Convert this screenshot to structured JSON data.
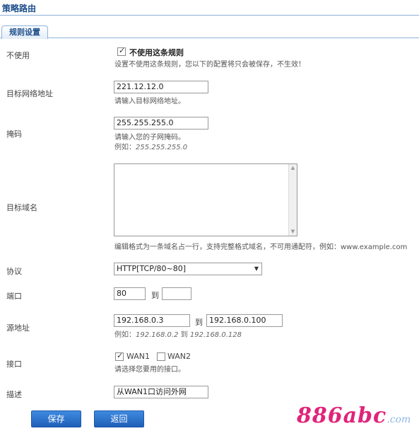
{
  "page": {
    "title": "策略路由"
  },
  "tabs": [
    {
      "label": "规则设置",
      "active": true
    }
  ],
  "form": {
    "disable": {
      "label": "不使用",
      "checkbox_label": "不使用这条规则",
      "checked": true,
      "hint": "设置不使用这条规则，您以下的配置将只会被保存，不生效！"
    },
    "dest_network": {
      "label": "目标网络地址",
      "value": "221.12.12.0",
      "hint": "请输入目标网络地址。"
    },
    "mask": {
      "label": "掩码",
      "value": "255.255.255.0",
      "hint": "请输入您的子网掩码。",
      "example_prefix": "例如：",
      "example_value": "255.255.255.0"
    },
    "dest_domain": {
      "label": "目标域名",
      "value": "",
      "hint": "编辑格式为一条域名占一行，支持完整格式域名，不可用通配符，例如：www.example.com"
    },
    "protocol": {
      "label": "协议",
      "selected": "HTTP[TCP/80~80]"
    },
    "port": {
      "label": "端口",
      "from": "80",
      "to_label": "到",
      "to": ""
    },
    "source": {
      "label": "源地址",
      "from": "192.168.0.3",
      "to_label": "到",
      "to": "192.168.0.100",
      "example_prefix": "例如：",
      "example_from": "192.168.0.2",
      "example_to_label": "到",
      "example_to": "192.168.0.128"
    },
    "interface": {
      "label": "接口",
      "options": [
        {
          "label": "WAN1",
          "checked": true
        },
        {
          "label": "WAN2",
          "checked": false
        }
      ],
      "hint": "请选择您要用的接口。"
    },
    "description": {
      "label": "描述",
      "value": "从WAN1口访问外网"
    }
  },
  "buttons": {
    "save": "保存",
    "back": "返回"
  },
  "watermark": {
    "main": "886abc",
    "sub": ".com"
  },
  "colors": {
    "accent": "#1b4d8a",
    "button": "#2f74cc",
    "watermark": "#e0247a"
  }
}
